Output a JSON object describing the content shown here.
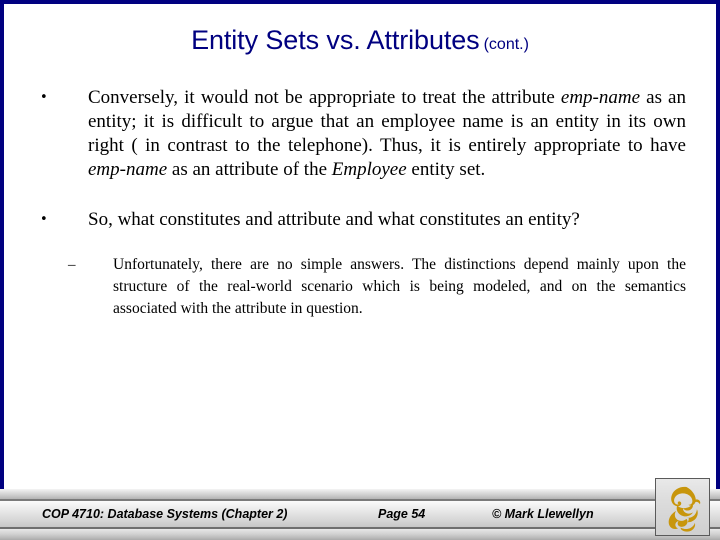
{
  "slide": {
    "title_main": "Entity Sets vs. Attributes",
    "title_suffix": "(cont.)",
    "accent_color": "#000080",
    "background_color": "#FFFFFF",
    "body_text_color": "#000000"
  },
  "bullets": [
    {
      "marker": "•",
      "parts": [
        {
          "text": "Conversely, it would not be appropriate to treat the attribute ",
          "style": "normal"
        },
        {
          "text": "emp-name",
          "style": "italic"
        },
        {
          "text": " as an entity; it is difficult to argue that an employee name is an entity in its own right ( in contrast to the telephone).  Thus, it is entirely appropriate to have ",
          "style": "normal"
        },
        {
          "text": "emp-name",
          "style": "italic"
        },
        {
          "text": " as an attribute of the ",
          "style": "normal"
        },
        {
          "text": "Employee",
          "style": "italic"
        },
        {
          "text": " entity set.",
          "style": "normal"
        }
      ]
    },
    {
      "marker": "•",
      "parts": [
        {
          "text": " So, what constitutes and attribute and what constitutes an entity?",
          "style": "normal"
        }
      ]
    }
  ],
  "sub_bullets": [
    {
      "marker": "–",
      "text": "Unfortunately, there are no simple answers.  The distinctions depend mainly upon the structure of the real-world scenario which is being modeled, and on the semantics associated with the attribute in question."
    }
  ],
  "footer": {
    "course": "COP 4710: Database Systems  (Chapter 2)",
    "page": "Page 54",
    "copyright": "© Mark Llewellyn",
    "logo_name": "pegasus-logo",
    "logo_color": "#C8960C"
  }
}
